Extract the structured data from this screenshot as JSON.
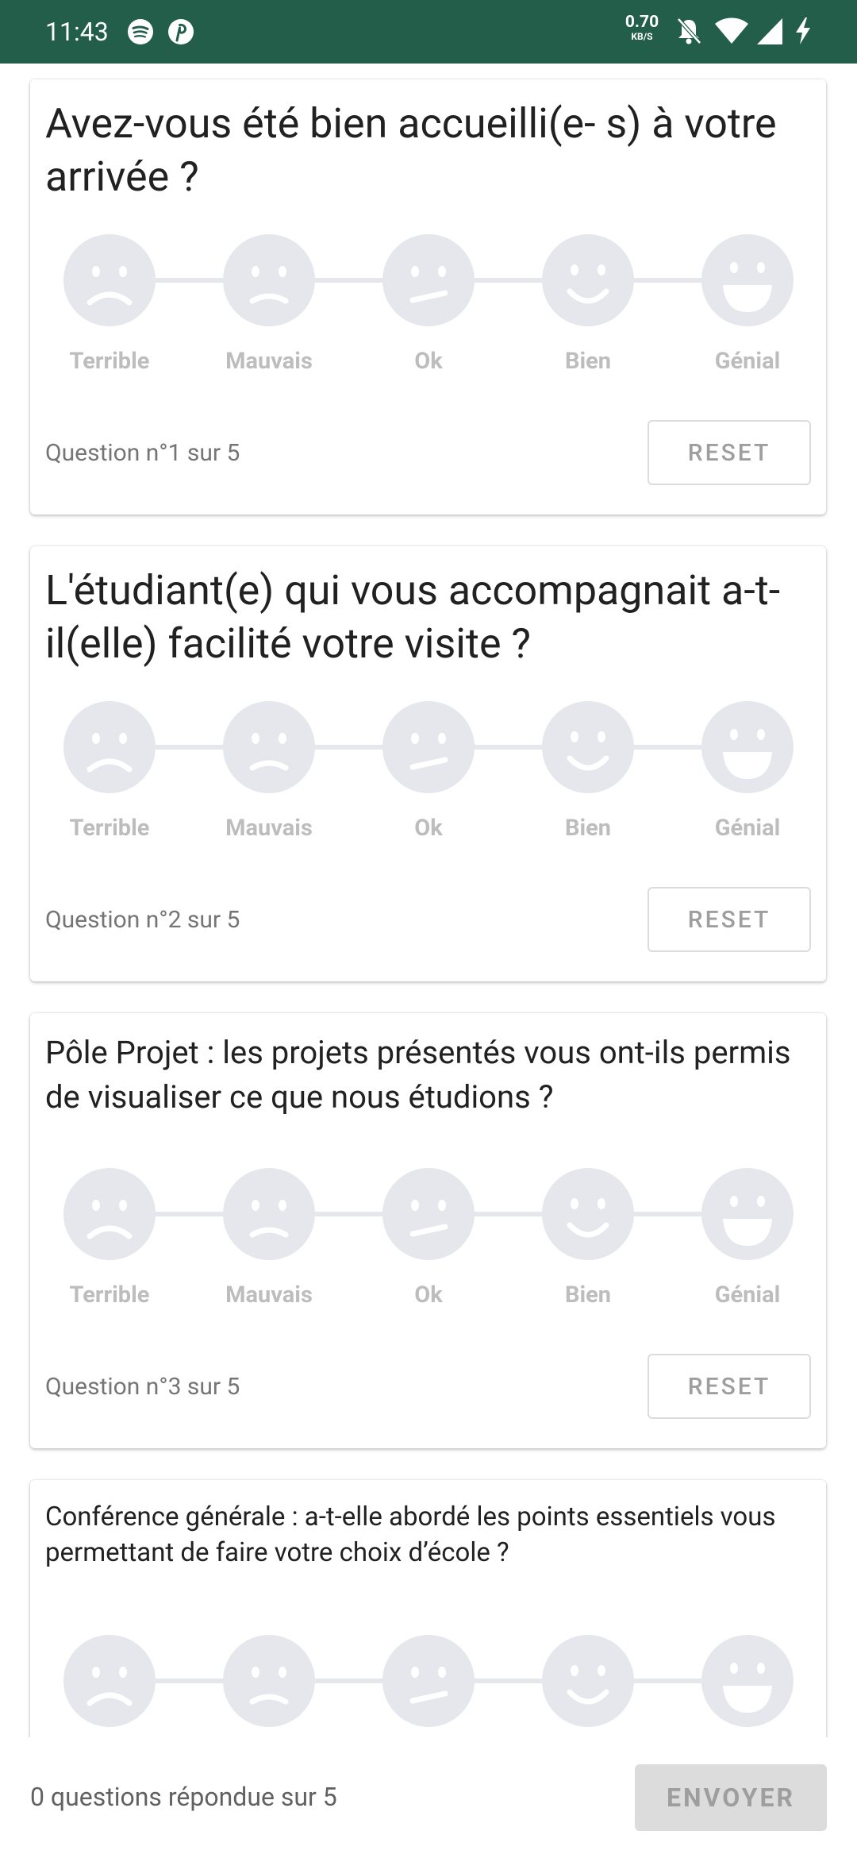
{
  "status_bar": {
    "time": "11:43",
    "net_speed": "0.70",
    "net_unit": "KB/S",
    "background": "#225e4a"
  },
  "rating_labels": [
    "Terrible",
    "Mauvais",
    "Ok",
    "Bien",
    "Génial"
  ],
  "questions": [
    {
      "text": "Avez-vous été bien accueilli(e- s) à votre arrivée ?",
      "counter": "Question n°1 sur 5",
      "reset_label": "RESET"
    },
    {
      "text": "L'étudiant(e) qui vous accompagnait a-t-il(elle) facilité votre visite ?",
      "counter": "Question n°2 sur 5",
      "reset_label": "RESET"
    },
    {
      "text": "Pôle Projet : les projets présentés vous ont-ils permis de visualiser ce que nous étudions ?",
      "counter": "Question n°3 sur 5",
      "reset_label": "RESET"
    },
    {
      "text": "Conférence générale : a-t-elle abordé les points essentiels vous permettant de faire votre choix d’école ?"
    }
  ],
  "footer": {
    "answered_text": "0 questions répondue sur 5",
    "send_label": "ENVOYER"
  },
  "colors": {
    "face_fill": "#e6e7ec",
    "label_text": "#bdbdbd"
  }
}
